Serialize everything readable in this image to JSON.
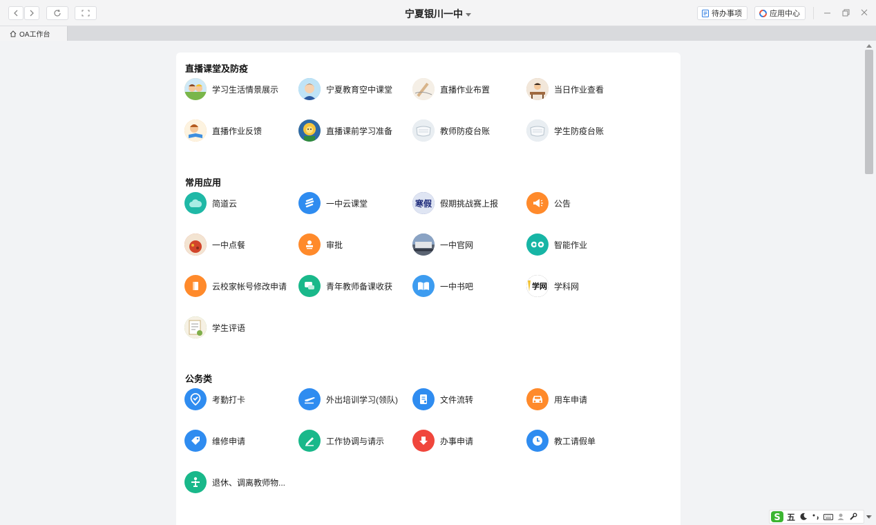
{
  "window": {
    "title": "宁夏银川一中",
    "todo_label": "待办事项",
    "appcenter_label": "应用中心"
  },
  "tabs": [
    {
      "label": "OA工作台"
    }
  ],
  "sections": [
    {
      "title": "直播课堂及防疫",
      "apps": [
        {
          "label": "学习生活情景展示",
          "icon": "cartoon-kids-icon",
          "color": "#f1b94a"
        },
        {
          "label": "宁夏教育空中课堂",
          "icon": "boy-avatar-icon",
          "color": "#4aa8e0"
        },
        {
          "label": "直播作业布置",
          "icon": "writing-hand-icon",
          "color": "#e8d9c4"
        },
        {
          "label": "当日作业查看",
          "icon": "student-desk-icon",
          "color": "#c9a27a"
        },
        {
          "label": "直播作业反馈",
          "icon": "child-reading-icon",
          "color": "#f2a23b"
        },
        {
          "label": "直播课前学习准备",
          "icon": "lion-mascot-icon",
          "color": "#f7c53c"
        },
        {
          "label": "教师防疫台账",
          "icon": "mask-icon",
          "color": "#c8d3dc"
        },
        {
          "label": "学生防疫台账",
          "icon": "mask-icon",
          "color": "#c8d3dc"
        }
      ]
    },
    {
      "title": "常用应用",
      "apps": [
        {
          "label": "简道云",
          "icon": "cloud-icon",
          "color": "#1fb8a6"
        },
        {
          "label": "一中云课堂",
          "icon": "stripes-icon",
          "color": "#2f8cf0"
        },
        {
          "label": "假期挑战赛上报",
          "icon": "holiday-text-icon",
          "color": "#2a3a8f"
        },
        {
          "label": "公告",
          "icon": "megaphone-icon",
          "color": "#ff8a2b"
        },
        {
          "label": "一中点餐",
          "icon": "food-icon",
          "color": "#d94a2a"
        },
        {
          "label": "审批",
          "icon": "stamp-icon",
          "color": "#ff8a2b"
        },
        {
          "label": "一中官网",
          "icon": "building-photo-icon",
          "color": "#6b7d99"
        },
        {
          "label": "智能作业",
          "icon": "owl-icon",
          "color": "#17b5a5"
        },
        {
          "label": "云校家帐号修改申请",
          "icon": "book-icon",
          "color": "#ff8a2b"
        },
        {
          "label": "青年教师备课收获",
          "icon": "chat-bubbles-icon",
          "color": "#19b88a"
        },
        {
          "label": "一中书吧",
          "icon": "open-book-icon",
          "color": "#3d9cf0"
        },
        {
          "label": "学科网",
          "icon": "xueke-logo-icon",
          "color": "#222222"
        },
        {
          "label": "学生评语",
          "icon": "certificate-icon",
          "color": "#7fae4a"
        }
      ]
    },
    {
      "title": "公务类",
      "apps": [
        {
          "label": "考勤打卡",
          "icon": "location-check-icon",
          "color": "#2f8cf0"
        },
        {
          "label": "外出培训学习(领队)",
          "icon": "airplane-icon",
          "color": "#2f8cf0"
        },
        {
          "label": "文件流转",
          "icon": "document-icon",
          "color": "#2f8cf0"
        },
        {
          "label": "用车申请",
          "icon": "car-icon",
          "color": "#ff8a2b"
        },
        {
          "label": "维修申请",
          "icon": "wrench-tag-icon",
          "color": "#2f8cf0"
        },
        {
          "label": "工作协调与请示",
          "icon": "pen-icon",
          "color": "#19b88a"
        },
        {
          "label": "办事申请",
          "icon": "download-arrow-icon",
          "color": "#f0463c"
        },
        {
          "label": "教工请假单",
          "icon": "clock-icon",
          "color": "#2f8cf0"
        },
        {
          "label": "退休、调离教师物...",
          "icon": "person-icon",
          "color": "#19b88a"
        }
      ]
    }
  ],
  "ime": {
    "mode_label": "五"
  }
}
